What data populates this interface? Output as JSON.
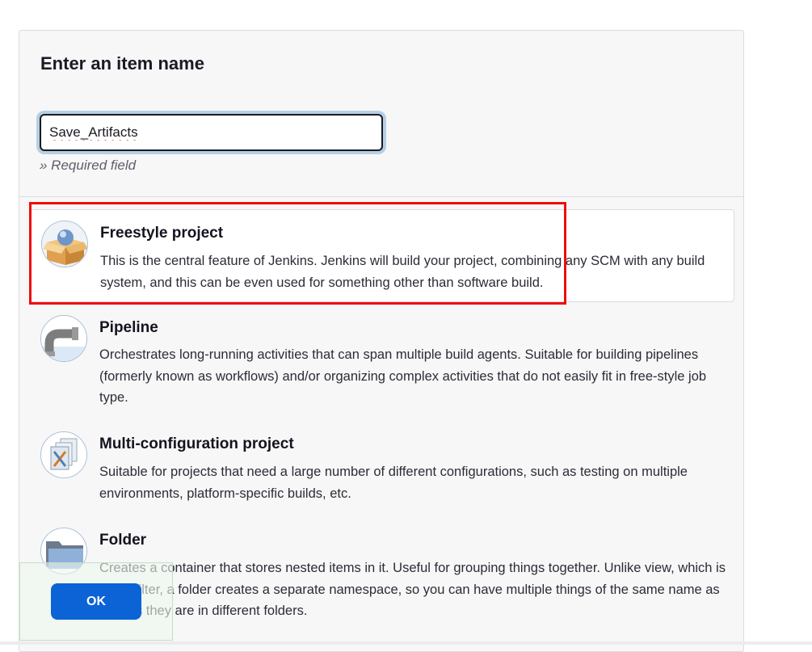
{
  "form": {
    "title": "Enter an item name",
    "item_name_value": "Save_Artifacts",
    "required_hint": "» Required field"
  },
  "items": [
    {
      "name": "Freestyle project",
      "description": "This is the central feature of Jenkins. Jenkins will build your project, combining any SCM with any build system, and this can be even used for something other than software build.",
      "icon": "freestyle-project-icon",
      "selected": true
    },
    {
      "name": "Pipeline",
      "description": "Orchestrates long-running activities that can span multiple build agents. Suitable for building pipelines (formerly known as workflows) and/or organizing complex activities that do not easily fit in free-style job type.",
      "icon": "pipeline-icon",
      "selected": false
    },
    {
      "name": "Multi-configuration project",
      "description": "Suitable for projects that need a large number of different configurations, such as testing on multiple environments, platform-specific builds, etc.",
      "icon": "multi-configuration-icon",
      "selected": false
    },
    {
      "name": "Folder",
      "description": "Creates a container that stores nested items in it. Useful for grouping things together. Unlike view, which is just a filter, a folder creates a separate namespace, so you can have multiple things of the same name as long as they are in different folders.",
      "icon": "folder-icon",
      "selected": false
    }
  ],
  "footer": {
    "ok_label": "OK"
  },
  "colors": {
    "accent": "#0b63d6",
    "highlight": "#ee0c0c"
  }
}
